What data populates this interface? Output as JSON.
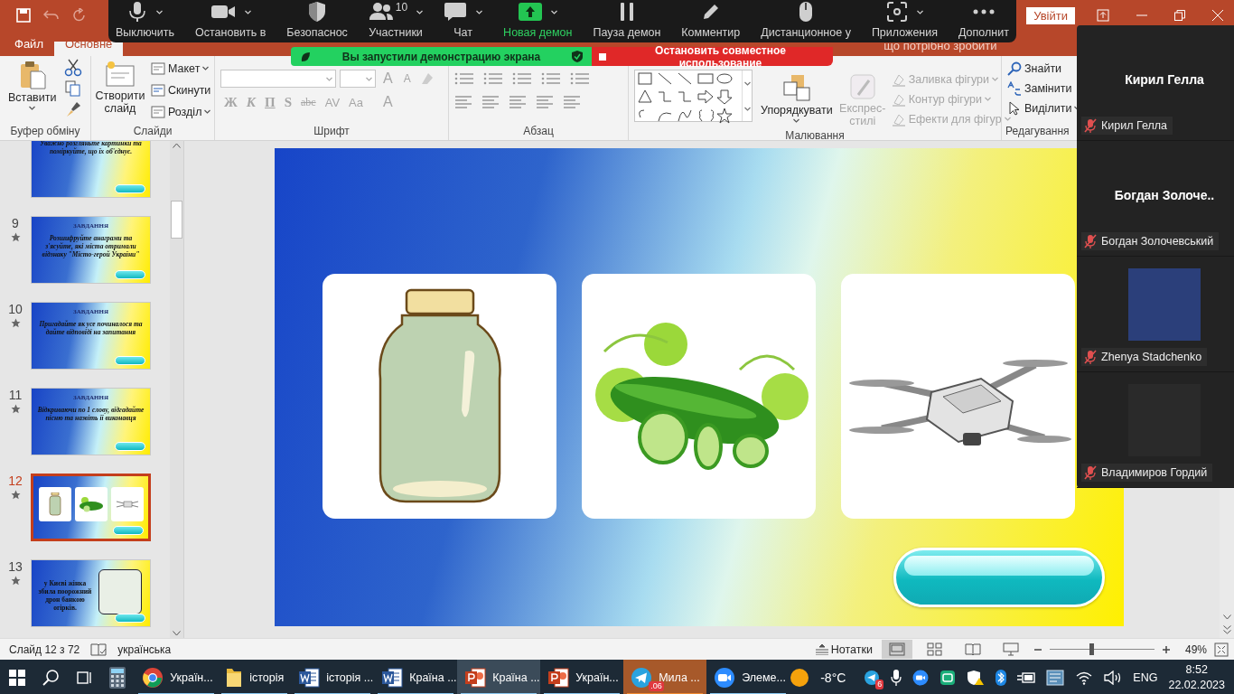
{
  "title_bar": {
    "sign_in": "Увійти"
  },
  "ribbon_tabs": [
    {
      "label": "Файл",
      "selected": false
    },
    {
      "label": "Основне",
      "selected": true
    }
  ],
  "tell_me": "що потрібно зробити",
  "ribbon": {
    "clipboard": {
      "label": "Буфер обміну",
      "paste": "Вставити"
    },
    "slides": {
      "label": "Слайди",
      "new_slide": "Створити слайд",
      "items": [
        "Макет",
        "Скинути",
        "Розділ"
      ]
    },
    "font": {
      "label": "Шрифт",
      "disabled": true,
      "size_buttons": [
        "A",
        "A"
      ],
      "format_buttons": [
        "Ж",
        "К",
        "П",
        "S",
        "abc",
        "AV",
        "Aa"
      ],
      "color_button": "A"
    },
    "paragraph": {
      "label": "Абзац"
    },
    "drawing": {
      "label": "Малювання",
      "arrange": "Упорядкувати",
      "quick_styles": {
        "label": "Експрес-стилі",
        "disabled": true
      },
      "shape_commands": [
        {
          "label": "Заливка фігури",
          "disabled": true
        },
        {
          "label": "Контур фігури",
          "disabled": true
        },
        {
          "label": "Ефекти для фігур",
          "disabled": true
        }
      ]
    },
    "editing": {
      "label": "Редагування",
      "commands": [
        {
          "kind": "find",
          "label": "Знайти"
        },
        {
          "kind": "replace",
          "label": "Замінити"
        },
        {
          "kind": "select",
          "label": "Виділити"
        }
      ]
    }
  },
  "slide_panel": {
    "slides": [
      {
        "kind": "text",
        "text": "Уважно розгляньте картинки та поміркуйте, що їх об'єднує.",
        "selected": false
      },
      {
        "kind": "text",
        "number": "9",
        "title": "ЗАВДАННЯ",
        "text": "Розшифруйте анаграми та з'ясуйте, які міста отримали відзнаку \"Місто-герой України\"",
        "selected": false
      },
      {
        "kind": "text",
        "number": "10",
        "title": "ЗАВДАННЯ",
        "text": "Пригадайте як усе починалося та дайте відповіді на запитання",
        "selected": false
      },
      {
        "kind": "text",
        "number": "11",
        "title": "ЗАВДАННЯ",
        "text": "Відкриваючи по 1 слову, відгадайте пісню та назвіть її виконавця",
        "selected": false
      },
      {
        "kind": "pictures",
        "number": "12",
        "selected": true
      },
      {
        "kind": "picture_text",
        "number": "13",
        "text": "у Києві жінка збила поорожний дрон банкою огірків.",
        "selected": false
      }
    ]
  },
  "slide": {
    "cards": [
      {
        "kind": "jar"
      },
      {
        "kind": "cucumber"
      },
      {
        "kind": "drone"
      }
    ]
  },
  "status_bar": {
    "slide_info": "Слайд 12 з 72",
    "language": "українська",
    "notes": "Нотатки",
    "views": [
      {
        "kind": "normal",
        "selected": true
      },
      {
        "kind": "sorter",
        "selected": false
      },
      {
        "kind": "reading",
        "selected": false
      },
      {
        "kind": "slideshow",
        "selected": false
      }
    ],
    "zoom": {
      "level": 0.4,
      "reading": "49%"
    }
  },
  "zoom_toolbar": {
    "items": [
      {
        "kind": "mic",
        "label": "Выключить",
        "dropdown": true,
        "active": false
      },
      {
        "kind": "video",
        "label": "Остановить в",
        "dropdown": true,
        "active": false
      },
      {
        "kind": "security",
        "label": "Безопаснос",
        "dropdown": false,
        "active": false
      },
      {
        "kind": "participants",
        "label": "Участники",
        "count": "10",
        "dropdown": true,
        "active": false
      },
      {
        "kind": "chat",
        "label": "Чат",
        "dropdown": true,
        "active": false
      },
      {
        "kind": "share",
        "label": "Новая демон",
        "dropdown": true,
        "active": true
      },
      {
        "kind": "pause",
        "label": "Пауза демон",
        "dropdown": false,
        "active": false
      },
      {
        "kind": "annotate",
        "label": "Комментир",
        "dropdown": false,
        "active": false
      },
      {
        "kind": "remote",
        "label": "Дистанционное у",
        "dropdown": false,
        "active": false
      },
      {
        "kind": "apps",
        "label": "Приложения",
        "dropdown": true,
        "active": false
      },
      {
        "kind": "more",
        "label": "Дополнит",
        "dropdown": false,
        "active": false
      }
    ]
  },
  "share_banner": {
    "status": "Вы запустили демонстрацию экрана",
    "stop": "Остановить совместное использование"
  },
  "participants": [
    {
      "kind": "name",
      "display": "Кирил Гелла",
      "name": "Кирил Гелла",
      "muted": true
    },
    {
      "kind": "name",
      "display": "Богдан  Золоче..",
      "name": "Богдан Золочевський",
      "muted": true
    },
    {
      "kind": "avatar",
      "name": "Zhenya Stadchenko",
      "muted": true
    },
    {
      "kind": "avatar",
      "name": "Владимиров Гордий",
      "muted": true
    }
  ],
  "taskbar": {
    "apps": [
      {
        "kind": "start",
        "running": false,
        "selected": false,
        "flashing": false
      },
      {
        "kind": "search",
        "running": false,
        "selected": false,
        "flashing": false
      },
      {
        "kind": "taskview",
        "running": false,
        "selected": false,
        "flashing": false
      },
      {
        "kind": "calculator",
        "running": false,
        "selected": false,
        "flashing": false
      },
      {
        "kind": "chrome",
        "label": "Україн...",
        "running": true,
        "selected": false,
        "flashing": false
      },
      {
        "kind": "folder",
        "label": "історія",
        "running": true,
        "selected": false,
        "flashing": false
      },
      {
        "kind": "word",
        "label": "історія ...",
        "running": true,
        "selected": false,
        "flashing": false
      },
      {
        "kind": "word",
        "label": "Країна ...",
        "running": true,
        "selected": false,
        "flashing": false
      },
      {
        "kind": "powerpoint",
        "label": "Країна ...",
        "running": true,
        "selected": true,
        "flashing": false
      },
      {
        "kind": "powerpoint",
        "label": "Україн...",
        "running": true,
        "selected": false,
        "flashing": false
      },
      {
        "kind": "telegram",
        "label": "Мила ...",
        "badge": ".06",
        "running": true,
        "selected": false,
        "flashing": true
      },
      {
        "kind": "zoom",
        "label": "Элеме...",
        "running": true,
        "selected": false,
        "flashing": false
      }
    ],
    "weather": "-8°C",
    "tray": [
      {
        "kind": "telegram",
        "badge": "6"
      },
      {
        "kind": "mic"
      },
      {
        "kind": "zoom"
      },
      {
        "kind": "app"
      },
      {
        "kind": "shield"
      },
      {
        "kind": "bluetooth"
      },
      {
        "kind": "power"
      },
      {
        "kind": "network"
      },
      {
        "kind": "wifi"
      },
      {
        "kind": "speaker"
      }
    ],
    "language": "ENG",
    "time": "8:52",
    "date": "22.02.2023"
  }
}
